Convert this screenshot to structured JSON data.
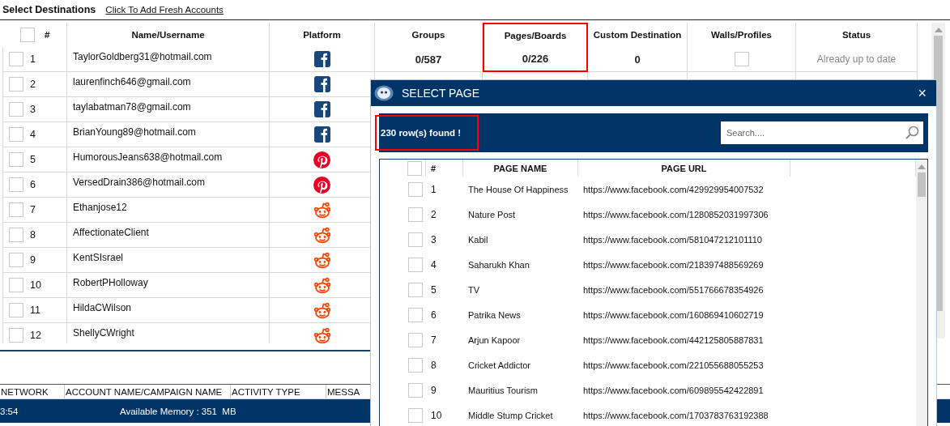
{
  "header": {
    "title": "Select Destinations",
    "link": "Click To Add Fresh Accounts"
  },
  "table": {
    "select_all_checked": false,
    "columns": [
      {
        "label": "#"
      },
      {
        "label": "Name/Username"
      },
      {
        "label": "Platform"
      },
      {
        "label": "Groups"
      },
      {
        "label": "Pages/Boards",
        "highlighted": true
      },
      {
        "label": "Custom Destination"
      },
      {
        "label": "Walls/Profiles"
      },
      {
        "label": "Status"
      }
    ],
    "rows": [
      {
        "checked": false,
        "number": "1",
        "name": "TaylorGoldberg31@hotmail.com",
        "kind": "facebook",
        "groups": "0/587",
        "pages": "0/226",
        "custom": "0",
        "walls_checked": false,
        "status": "Already up to date"
      },
      {
        "checked": false,
        "number": "2",
        "name": "laurenfinch646@gmail.com",
        "kind": "facebook"
      },
      {
        "checked": false,
        "number": "3",
        "name": "taylabatman78@gmail.com",
        "kind": "facebook"
      },
      {
        "checked": false,
        "number": "4",
        "name": "BrianYoung89@hotmail.com",
        "kind": "facebook"
      },
      {
        "checked": false,
        "number": "5",
        "name": "HumorousJeans638@hotmail.com",
        "kind": "pinterest"
      },
      {
        "checked": false,
        "number": "6",
        "name": "VersedDrain386@hotmail.com",
        "kind": "pinterest"
      },
      {
        "checked": false,
        "number": "7",
        "name": "Ethanjose12",
        "kind": "reddit"
      },
      {
        "checked": false,
        "number": "8",
        "name": "AffectionateClient",
        "kind": "reddit"
      },
      {
        "checked": false,
        "number": "9",
        "name": "KentSIsrael",
        "kind": "reddit"
      },
      {
        "checked": false,
        "number": "10",
        "name": "RobertPHolloway",
        "kind": "reddit"
      },
      {
        "checked": false,
        "number": "11",
        "name": "HildaCWilson",
        "kind": "reddit"
      },
      {
        "checked": false,
        "number": "12",
        "name": "ShellyCWright",
        "kind": "reddit"
      }
    ]
  },
  "log_table": {
    "columns": [
      "NETWORK",
      "ACCOUNT NAME/CAMPAIGN NAME",
      "ACTIVITY TYPE",
      "MESSA"
    ]
  },
  "status_bar": {
    "time": "3:54",
    "memory": "Available Memory : 351  MB"
  },
  "dialog": {
    "title": "SELECT PAGE",
    "close": "×",
    "count": "230 row(s) found !",
    "count_highlighted": true,
    "search": {
      "placeholder": "Search...."
    },
    "select_all_checked": false,
    "columns": [
      "#",
      "PAGE NAME",
      "PAGE URL"
    ],
    "rows": [
      {
        "checked": false,
        "number": "1",
        "name": "The House Of Happiness",
        "url": "https://www.facebook.com/429929954007532"
      },
      {
        "checked": false,
        "number": "2",
        "name": "Nature Post",
        "url": "https://www.facebook.com/1280852031997306"
      },
      {
        "checked": false,
        "number": "3",
        "name": "Kabil",
        "url": "https://www.facebook.com/581047212101110"
      },
      {
        "checked": false,
        "number": "4",
        "name": "Saharukh Khan",
        "url": "https://www.facebook.com/218397488569269"
      },
      {
        "checked": false,
        "number": "5",
        "name": "TV",
        "url": "https://www.facebook.com/551766678354926"
      },
      {
        "checked": false,
        "number": "6",
        "name": "Patrika News",
        "url": "https://www.facebook.com/160869410602719"
      },
      {
        "checked": false,
        "number": "7",
        "name": "Arjun Kapoor",
        "url": "https://www.facebook.com/442125805887831"
      },
      {
        "checked": false,
        "number": "8",
        "name": "Cricket Addictor",
        "url": "https://www.facebook.com/221055688055253"
      },
      {
        "checked": false,
        "number": "9",
        "name": "Mauritius Tourism",
        "url": "https://www.facebook.com/609895542422891"
      },
      {
        "checked": false,
        "number": "10",
        "name": "Middle Stump Cricket",
        "url": "https://www.facebook.com/1703783763192388"
      }
    ]
  }
}
